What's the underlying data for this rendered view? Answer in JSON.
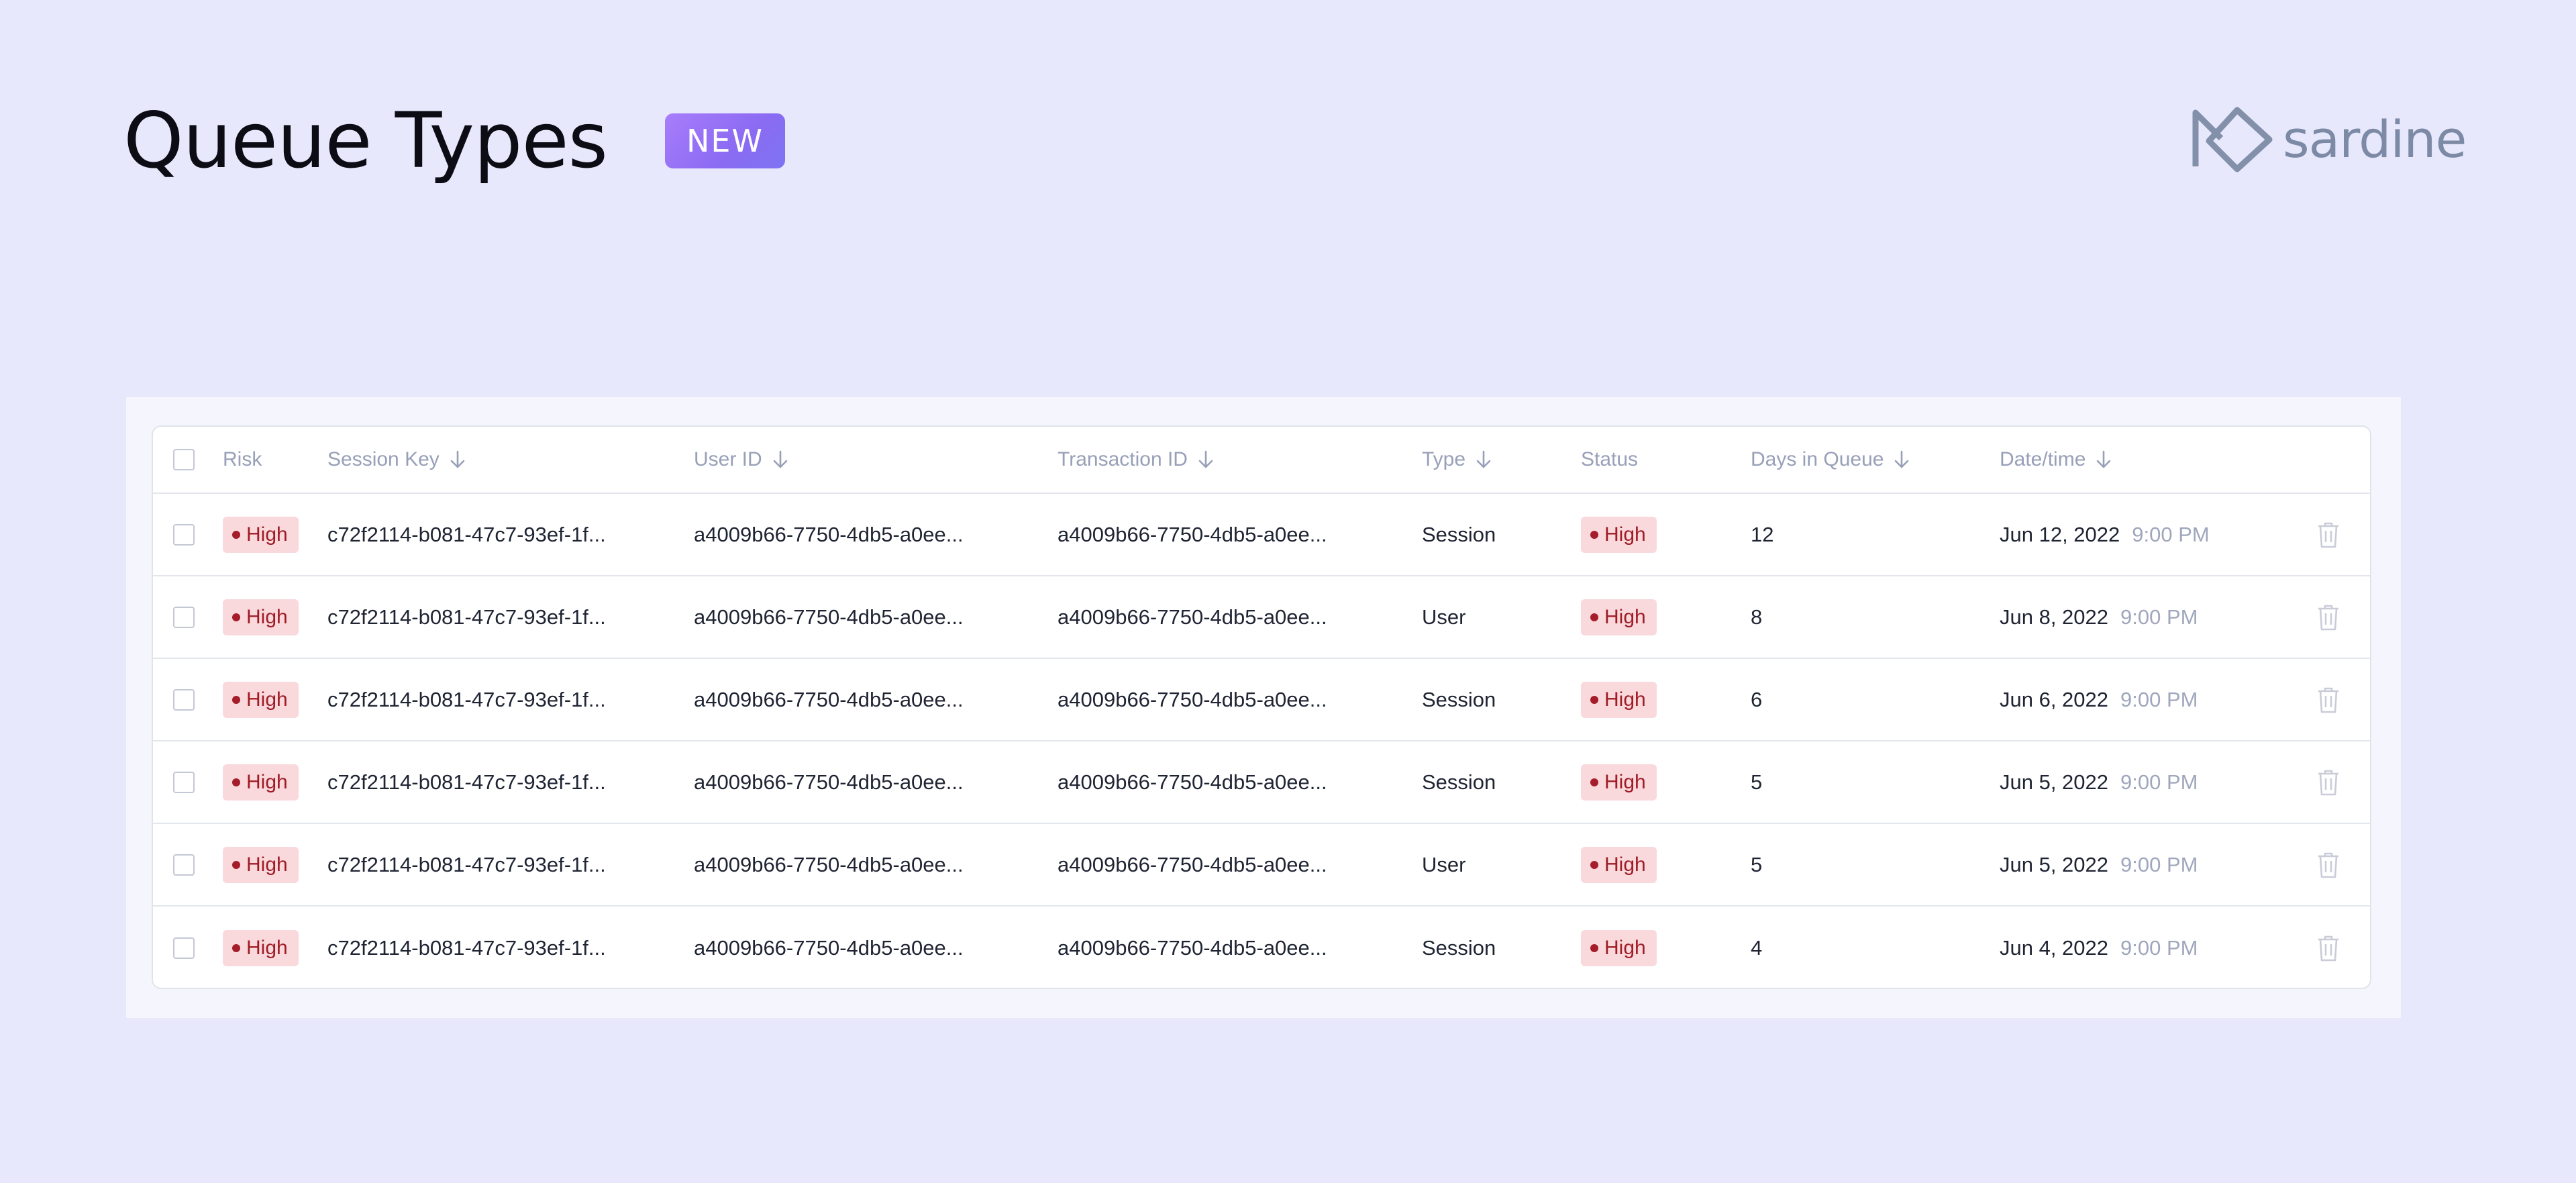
{
  "header": {
    "title": "Queue Types",
    "badge": "NEW",
    "brand_name": "sardine"
  },
  "colors": {
    "background": "#e8e8fd",
    "badge_gradient_start": "#a87dfa",
    "badge_gradient_end": "#7d74f2",
    "risk_high_bg": "#f9d9dc",
    "risk_high_text": "#9f1c27",
    "brand": "#7c8aa5"
  },
  "icons": {
    "brand_logo": "sardine-logo-icon",
    "sort": "arrow-down-icon",
    "delete": "trash-icon",
    "risk_dot": "dot-icon"
  },
  "table": {
    "columns": {
      "risk": "Risk",
      "session_key": "Session Key",
      "user_id": "User ID",
      "transaction_id": "Transaction ID",
      "type": "Type",
      "status": "Status",
      "days_in_queue": "Days in Queue",
      "datetime": "Date/time"
    },
    "rows": [
      {
        "risk": "High",
        "session_key": "c72f2114-b081-47c7-93ef-1f...",
        "user_id": "a4009b66-7750-4db5-a0ee...",
        "transaction_id": "a4009b66-7750-4db5-a0ee...",
        "type": "Session",
        "status": "High",
        "days": "12",
        "date": "Jun 12, 2022",
        "time": "9:00 PM"
      },
      {
        "risk": "High",
        "session_key": "c72f2114-b081-47c7-93ef-1f...",
        "user_id": "a4009b66-7750-4db5-a0ee...",
        "transaction_id": "a4009b66-7750-4db5-a0ee...",
        "type": "User",
        "status": "High",
        "days": "8",
        "date": "Jun 8, 2022",
        "time": "9:00 PM"
      },
      {
        "risk": "High",
        "session_key": "c72f2114-b081-47c7-93ef-1f...",
        "user_id": "a4009b66-7750-4db5-a0ee...",
        "transaction_id": "a4009b66-7750-4db5-a0ee...",
        "type": "Session",
        "status": "High",
        "days": "6",
        "date": "Jun 6, 2022",
        "time": "9:00 PM"
      },
      {
        "risk": "High",
        "session_key": "c72f2114-b081-47c7-93ef-1f...",
        "user_id": "a4009b66-7750-4db5-a0ee...",
        "transaction_id": "a4009b66-7750-4db5-a0ee...",
        "type": "Session",
        "status": "High",
        "days": "5",
        "date": "Jun 5, 2022",
        "time": "9:00 PM"
      },
      {
        "risk": "High",
        "session_key": "c72f2114-b081-47c7-93ef-1f...",
        "user_id": "a4009b66-7750-4db5-a0ee...",
        "transaction_id": "a4009b66-7750-4db5-a0ee...",
        "type": "User",
        "status": "High",
        "days": "5",
        "date": "Jun 5, 2022",
        "time": "9:00 PM"
      },
      {
        "risk": "High",
        "session_key": "c72f2114-b081-47c7-93ef-1f...",
        "user_id": "a4009b66-7750-4db5-a0ee...",
        "transaction_id": "a4009b66-7750-4db5-a0ee...",
        "type": "Session",
        "status": "High",
        "days": "4",
        "date": "Jun 4, 2022",
        "time": "9:00 PM"
      }
    ]
  }
}
